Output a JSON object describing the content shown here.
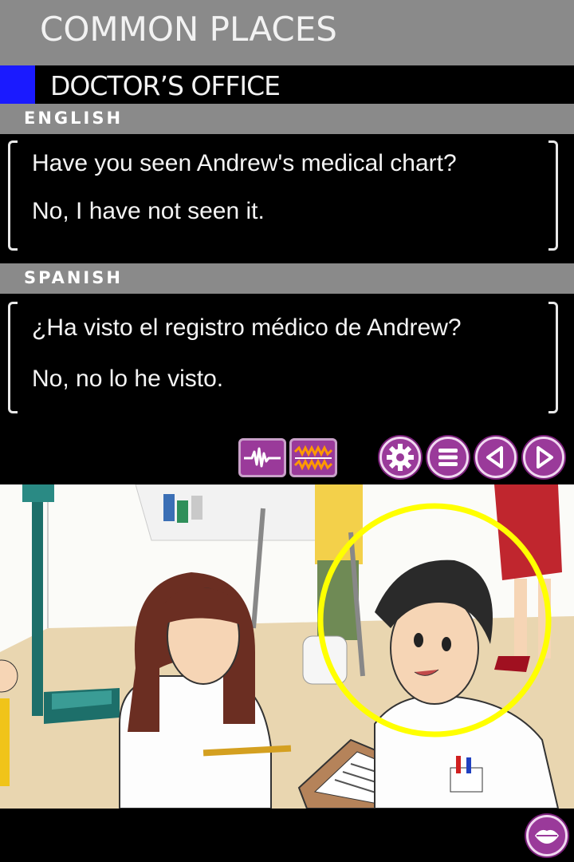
{
  "header": {
    "title": "COMMON PLACES",
    "subtitle": "DOCTOR’S OFFICE"
  },
  "english": {
    "label": "ENGLISH",
    "lines": [
      "Have you seen Andrew's medical chart?",
      "No, I have not seen it."
    ]
  },
  "spanish": {
    "label": "SPANISH",
    "lines": [
      "¿Ha visto el registro médico de Andrew?",
      "No, no lo he visto."
    ]
  },
  "controls": {
    "audio_normal_icon": "waveform-icon",
    "audio_slow_icon": "waveform-slow-icon",
    "settings_icon": "gear-icon",
    "menu_icon": "menu-icon",
    "prev_icon": "triangle-left-icon",
    "next_icon": "triangle-right-icon",
    "speak_icon": "lips-icon"
  },
  "colors": {
    "accent_blue": "#1a1aff",
    "button_purple": "#9a3a9a",
    "highlight_yellow": "#ffff00",
    "waveform_orange": "#ff9900"
  }
}
